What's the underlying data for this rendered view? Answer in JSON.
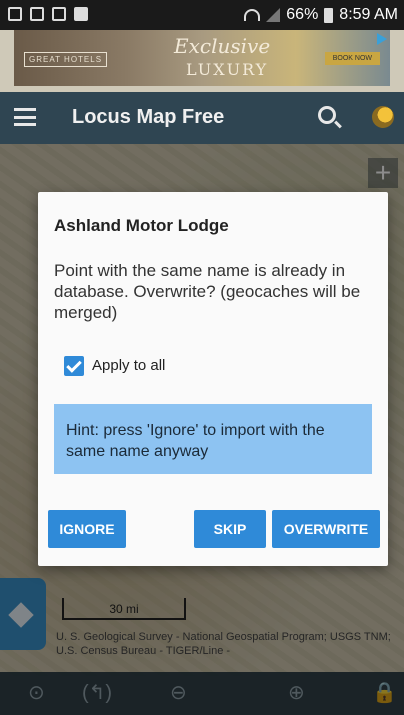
{
  "status_bar": {
    "battery": "66%",
    "time": "8:59 AM",
    "icons": [
      "image-icon",
      "voicemail-icon",
      "receipt-icon",
      "facebook-icon",
      "wifi-icon",
      "signal-icon",
      "battery-icon"
    ]
  },
  "ad": {
    "brand": "GREAT HOTELS",
    "headline": "Exclusive",
    "subheadline": "LUXURY",
    "cta": "BOOK NOW"
  },
  "app_bar": {
    "title": "Locus Map Free",
    "icons": [
      "menu-icon",
      "search-icon",
      "satellite-icon"
    ]
  },
  "map": {
    "scale_label": "30 mi",
    "attribution": "U. S. Geological Survey - National Geospatial Program; USGS TNM; U.S. Census Bureau - TIGER/Line -",
    "zoom_in_symbol": "+"
  },
  "dialog": {
    "title": "Ashland Motor Lodge",
    "message": "Point with the same name is already in database. Overwrite? (geocaches will be merged)",
    "checkbox_label": "Apply to all",
    "checkbox_checked": true,
    "hint": "Hint: press 'Ignore' to import with the same name anyway",
    "buttons": {
      "ignore": "IGNORE",
      "skip": "SKIP",
      "overwrite": "OVERWRITE"
    }
  },
  "bottom_bar": {
    "locate_symbol": "⊙",
    "rotate_symbol": "(↰)",
    "zoom_out_symbol": "⊖",
    "zoom_in_symbol": "⊕",
    "lock_symbol": "🔒"
  },
  "colors": {
    "accent": "#2f8ad8",
    "hint_bg": "#8dc3f2",
    "app_bar": "#2f4552"
  }
}
